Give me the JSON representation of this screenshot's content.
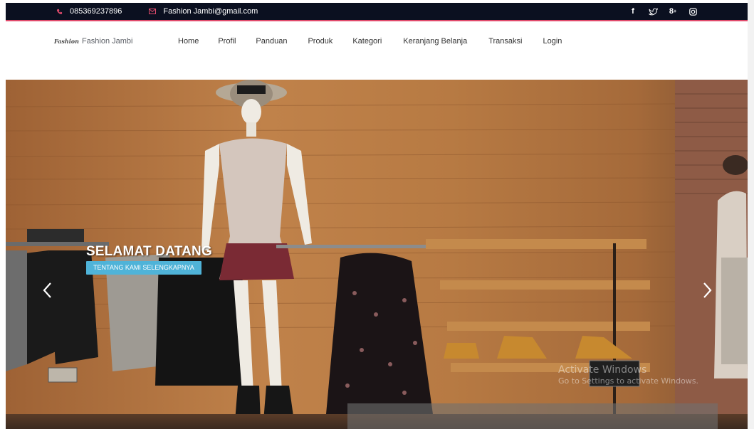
{
  "topbar": {
    "phone": "085369237896",
    "email": "Fashion Jambi@gmail.com",
    "social": [
      "f",
      "twitter",
      "8+",
      "instagram"
    ]
  },
  "brand": {
    "logo_text": "Fashion",
    "name": "Fashion Jambi"
  },
  "nav": {
    "items": [
      "Home",
      "Profil",
      "Panduan",
      "Produk",
      "Kategori",
      "Keranjang Belanja",
      "Transaksi",
      "Login"
    ]
  },
  "hero": {
    "title": "SELAMAT DATANG",
    "button_label": "TENTANG KAMI SELENGKAPNYA",
    "prev_icon": "chevron-left-icon",
    "next_icon": "chevron-right-icon"
  },
  "watermark": {
    "line1": "Activate Windows",
    "line2": "Go to Settings to activate Windows."
  },
  "colors": {
    "topbar_bg": "#0b1020",
    "accent_line": "#e14b6c",
    "button_bg": "#4fb3d8"
  }
}
